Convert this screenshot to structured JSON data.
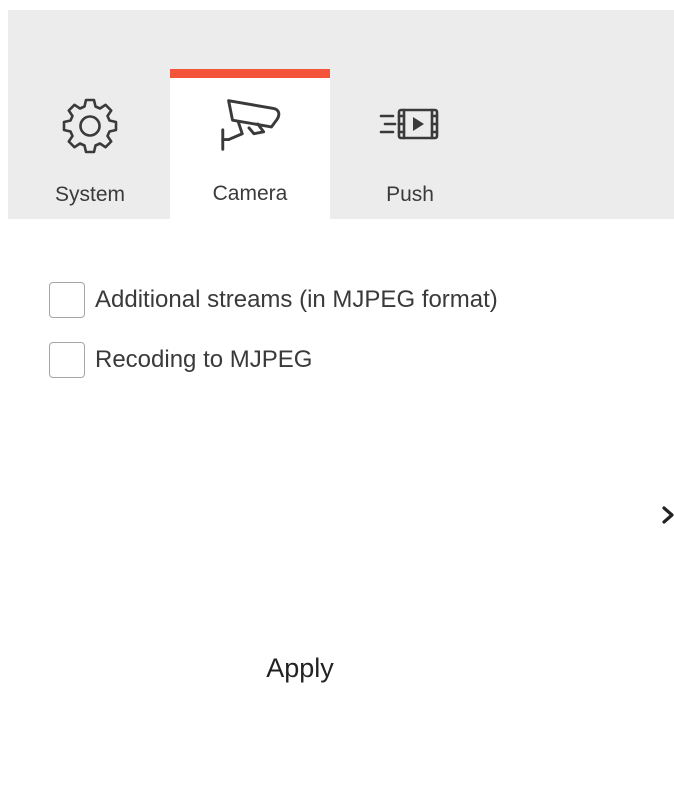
{
  "tabs": [
    {
      "label": "System",
      "icon": "gear-icon",
      "active": false
    },
    {
      "label": "Camera",
      "icon": "cctv-camera-icon",
      "active": true
    },
    {
      "label": "Push",
      "icon": "fast-forward-video-icon",
      "active": false
    }
  ],
  "options": [
    {
      "label": "Additional streams (in MJPEG format)",
      "checked": false
    },
    {
      "label": "Recoding to MJPEG",
      "checked": false
    }
  ],
  "apply_label": "Apply",
  "colors": {
    "active_tab_accent": "#f4553a",
    "tabbar_background": "#ececec",
    "text": "#3a3a3a"
  }
}
